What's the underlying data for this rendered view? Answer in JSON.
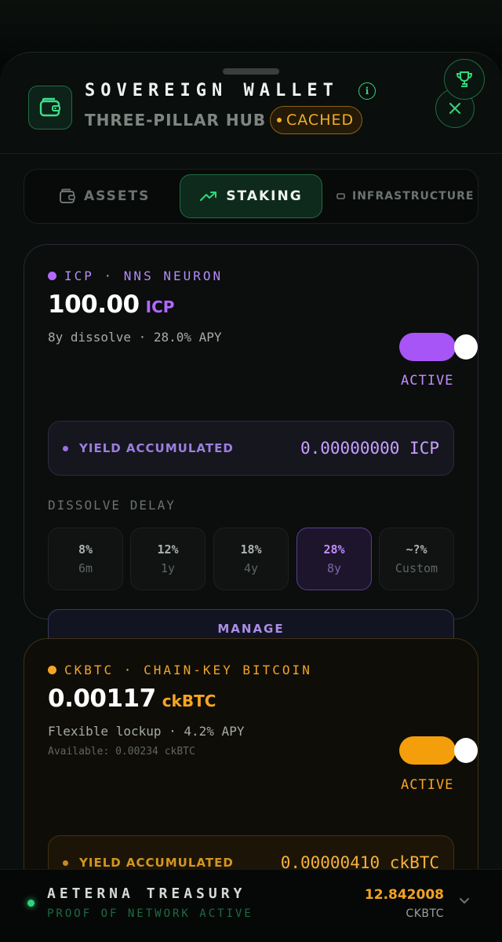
{
  "header": {
    "title": "SOVEREIGN WALLET",
    "subtitle": "THREE-PILLAR HUB",
    "cache_badge": "CACHED"
  },
  "tabs": [
    {
      "label": "ASSETS",
      "icon": "wallet-icon",
      "selected": false
    },
    {
      "label": "STAKING",
      "icon": "trend-up-icon",
      "selected": true
    },
    {
      "label": "INFRASTRUCTURE",
      "icon": "server-icon",
      "selected": false
    }
  ],
  "icp_card": {
    "kicker": "ICP · NNS NEURON",
    "amount": "100.00",
    "unit": "ICP",
    "detail": "8y dissolve · 28.0% APY",
    "status": "ACTIVE",
    "toggle_on": true,
    "yield_label": "YIELD ACCUMULATED",
    "yield_value": "0.00000000 ICP",
    "dissolve_label": "DISSOLVE DELAY",
    "options": [
      {
        "pct": "8%",
        "dur": "6m"
      },
      {
        "pct": "12%",
        "dur": "1y"
      },
      {
        "pct": "18%",
        "dur": "4y"
      },
      {
        "pct": "28%",
        "dur": "8y"
      },
      {
        "pct": "~?%",
        "dur": "Custom"
      }
    ],
    "selected_option": 3,
    "manage_label": "MANAGE",
    "accent": "#b168ff"
  },
  "btc_card": {
    "kicker": "CKBTC · CHAIN-KEY BITCOIN",
    "amount": "0.00117",
    "unit": "ckBTC",
    "detail": "Flexible lockup · 4.2% APY",
    "available": "Available: 0.00234 ckBTC",
    "status": "ACTIVE",
    "toggle_on": true,
    "yield_label": "YIELD ACCUMULATED",
    "yield_value": "0.00000410 ckBTC",
    "accent": "#f5a524"
  },
  "footer": {
    "title": "AETERNA TREASURY",
    "subtitle": "PROOF OF NETWORK ACTIVE",
    "amount": "12.842008",
    "unit": "CKBTC"
  },
  "colors": {
    "brand_green": "#32d77a",
    "background": "#0a0e0c"
  }
}
